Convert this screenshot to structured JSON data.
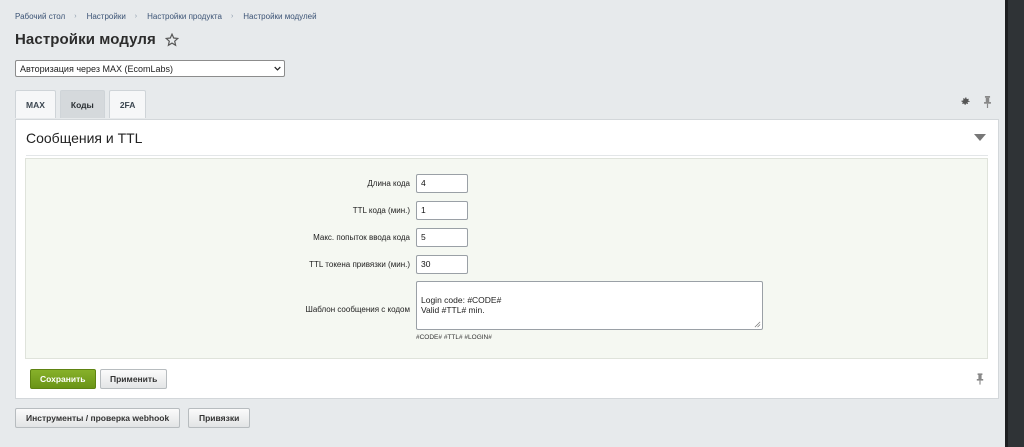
{
  "breadcrumb": [
    "Рабочий стол",
    "Настройки",
    "Настройки продукта",
    "Настройки модулей"
  ],
  "page": {
    "title": "Настройки модуля"
  },
  "module_select": {
    "selected": "Авторизация через MAX (EcomLabs)"
  },
  "tabs": [
    {
      "label": "MAX",
      "active": false
    },
    {
      "label": "Коды",
      "active": true
    },
    {
      "label": "2FA",
      "active": false
    }
  ],
  "panel": {
    "title": "Сообщения и TTL",
    "fields": [
      {
        "label": "Длина кода",
        "value": "4"
      },
      {
        "label": "TTL кода (мин.)",
        "value": "1"
      },
      {
        "label": "Макс. попыток ввода кода",
        "value": "5"
      },
      {
        "label": "TTL токена привязки (мин.)",
        "value": "30"
      }
    ],
    "template": {
      "label": "Шаблон сообщения с кодом",
      "value": "Login code: #CODE#\nValid #TTL# min.",
      "hint": "#CODE# #TTL# #LOGIN#"
    },
    "buttons": {
      "save": "Сохранить",
      "apply": "Применить"
    }
  },
  "bottom_buttons": {
    "tools": "Инструменты / проверка webhook",
    "bindings": "Привязки"
  },
  "icons": {
    "star": "star-icon",
    "settings": "gear-icon",
    "pin": "pin-icon",
    "collapse": "chevron-down-icon"
  },
  "colors": {
    "save_button": "#6f9a1a",
    "background": "#e7eaec",
    "form_area": "#f5f8f2"
  }
}
